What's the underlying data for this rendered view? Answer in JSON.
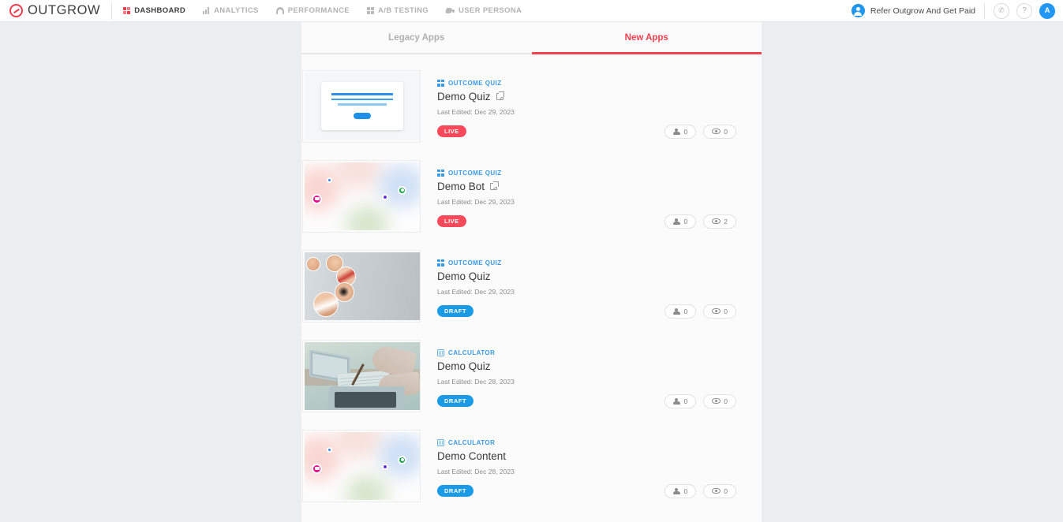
{
  "header": {
    "brand": "OUTGROW",
    "brand_icon": "outgrow-logo-icon",
    "nav": [
      {
        "label": "DASHBOARD",
        "icon": "grid-icon",
        "active": true
      },
      {
        "label": "ANALYTICS",
        "icon": "bars-icon",
        "active": false
      },
      {
        "label": "PERFORMANCE",
        "icon": "speedometer-icon",
        "active": false
      },
      {
        "label": "A/B TESTING",
        "icon": "ab-split-icon",
        "active": false
      },
      {
        "label": "USER PERSONA",
        "icon": "tag-icon",
        "active": false
      }
    ],
    "refer_label": "Refer Outgrow And Get Paid",
    "refer_icon": "refer-badge-icon",
    "phone_icon": "phone-icon",
    "help_icon": "question-mark-icon",
    "help_glyph": "?",
    "phone_glyph": "✆",
    "avatar_initial": "A",
    "accent_red": "#ee3c4b",
    "accent_blue": "#2196f3"
  },
  "tabs": [
    {
      "label": "Legacy Apps",
      "active": false
    },
    {
      "label": "New Apps",
      "active": true
    }
  ],
  "apps": [
    {
      "type": "OUTCOME QUIZ",
      "type_icon": "outcome-quiz-icon",
      "title": "Demo Quiz",
      "has_external_link": true,
      "edited": "Last Edited: Dec 29, 2023",
      "status": "LIVE",
      "status_color": "#f84a5a",
      "users": "0",
      "views": "0",
      "thumbnail": "wireframe-mockup"
    },
    {
      "type": "OUTCOME QUIZ",
      "type_icon": "outcome-quiz-icon",
      "title": "Demo Bot",
      "has_external_link": true,
      "edited": "Last Edited: Dec 29, 2023",
      "status": "LIVE",
      "status_color": "#f84a5a",
      "users": "0",
      "views": "2",
      "thumbnail": "pastel-blobs"
    },
    {
      "type": "OUTCOME QUIZ",
      "type_icon": "outcome-quiz-icon",
      "title": "Demo Quiz",
      "has_external_link": false,
      "edited": "Last Edited: Dec 29, 2023",
      "status": "DRAFT",
      "status_color": "#1b9ae6",
      "users": "0",
      "views": "0",
      "thumbnail": "skin-closeups"
    },
    {
      "type": "CALCULATOR",
      "type_icon": "calculator-icon",
      "title": "Demo Quiz",
      "has_external_link": false,
      "edited": "Last Edited: Dec 28, 2023",
      "status": "DRAFT",
      "status_color": "#1b9ae6",
      "users": "0",
      "views": "0",
      "thumbnail": "desk-laptops-photo"
    },
    {
      "type": "CALCULATOR",
      "type_icon": "calculator-icon",
      "title": "Demo Content",
      "has_external_link": false,
      "edited": "Last Edited: Dec 28, 2023",
      "status": "DRAFT",
      "status_color": "#1b9ae6",
      "users": "0",
      "views": "0",
      "thumbnail": "pastel-blobs"
    }
  ]
}
